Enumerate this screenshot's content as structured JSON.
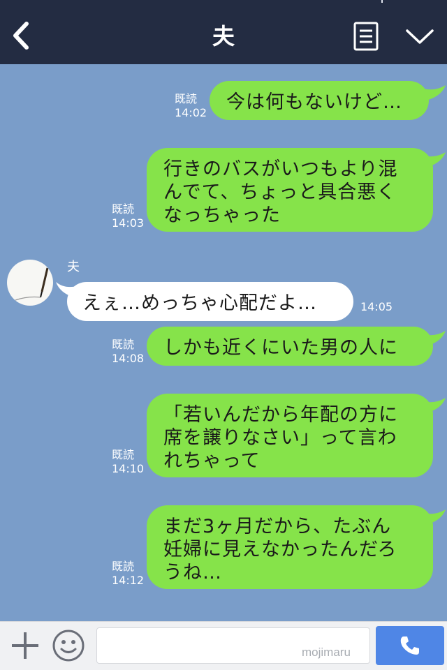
{
  "header": {
    "title": "夫",
    "back_icon": "chevron-left-icon",
    "menu_icon": "menu-lines-icon",
    "collapse_icon": "chevron-down-icon"
  },
  "messages": [
    {
      "direction": "out",
      "read_label": "既読",
      "time": "14:02",
      "text": "今は何もないけど…"
    },
    {
      "direction": "out",
      "read_label": "既読",
      "time": "14:03",
      "text": "行きのバスがいつもより混\nんでて、ちょっと具合悪く\nなっちゃった"
    },
    {
      "direction": "in",
      "sender": "夫",
      "time": "14:05",
      "text": "えぇ…めっちゃ心配だよ…"
    },
    {
      "direction": "out",
      "read_label": "既読",
      "time": "14:08",
      "text": "しかも近くにいた男の人に"
    },
    {
      "direction": "out",
      "read_label": "既読",
      "time": "14:10",
      "text": "「若いんだから年配の方に\n席を譲りなさい」って言わ\nれちゃって"
    },
    {
      "direction": "out",
      "read_label": "既読",
      "time": "14:12",
      "text": "まだ3ヶ月だから、たぶん\n妊婦に見えなかったんだろ\nうね…"
    }
  ],
  "footer": {
    "input_value": "",
    "input_placeholder": "",
    "watermark": "mojimaru",
    "plus_icon": "plus-icon",
    "emoji_icon": "smiley-icon",
    "call_icon": "phone-icon"
  },
  "colors": {
    "header_bg": "#232c42",
    "chat_bg": "#7a9dc9",
    "outgoing_bubble": "#86e34a",
    "incoming_bubble": "#ffffff",
    "call_button": "#4f86e6"
  }
}
